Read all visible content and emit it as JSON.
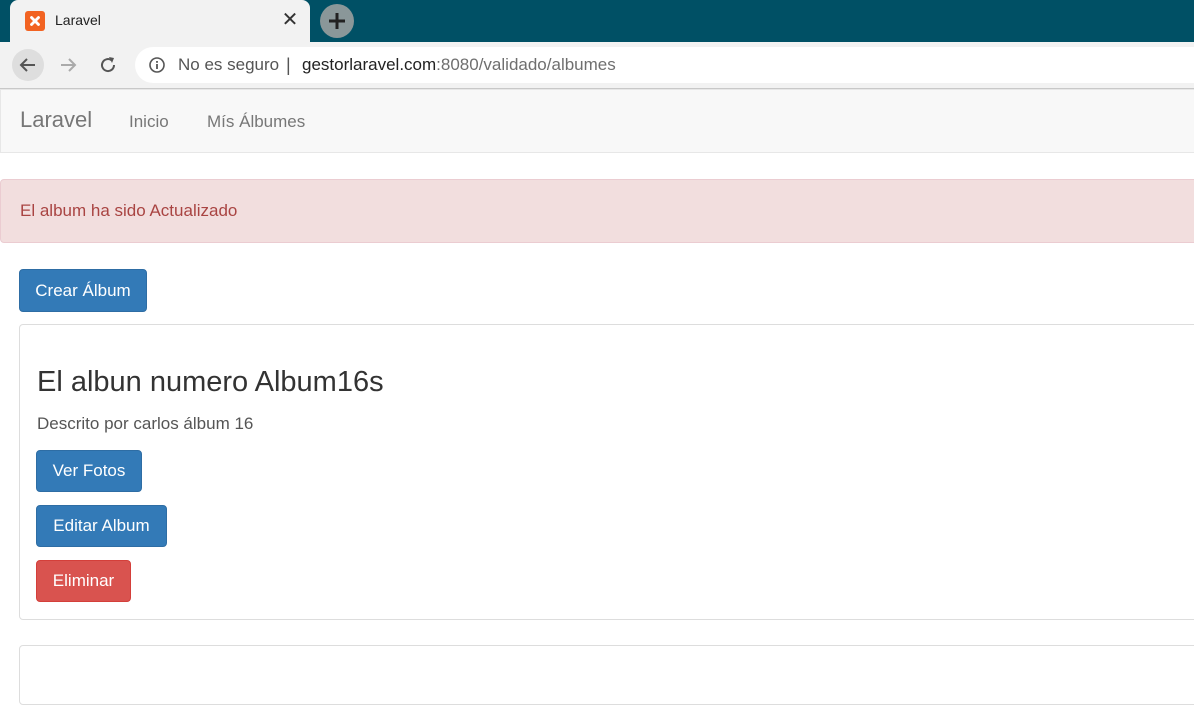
{
  "browser": {
    "tab_title": "Laravel",
    "security_label": "No es seguro",
    "separator": "|",
    "url_host": "gestorlaravel.com",
    "url_rest": ":8080/validado/albumes"
  },
  "navbar": {
    "brand": "Laravel",
    "links": [
      "Inicio",
      "Mís Álbumes"
    ]
  },
  "alert": {
    "message": "El album ha sido Actualizado"
  },
  "actions": {
    "create_label": "Crear Álbum"
  },
  "albums": [
    {
      "title": "El albun numero Album16s",
      "description": "Descrito por carlos álbum 16",
      "buttons": [
        "Ver Fotos",
        "Editar Album",
        "Eliminar"
      ]
    }
  ],
  "colors": {
    "chrome_tabstrip": "#005065",
    "primary": "#337ab7",
    "danger": "#d9534f",
    "alert_bg": "#f2dede",
    "alert_text": "#a94442"
  }
}
